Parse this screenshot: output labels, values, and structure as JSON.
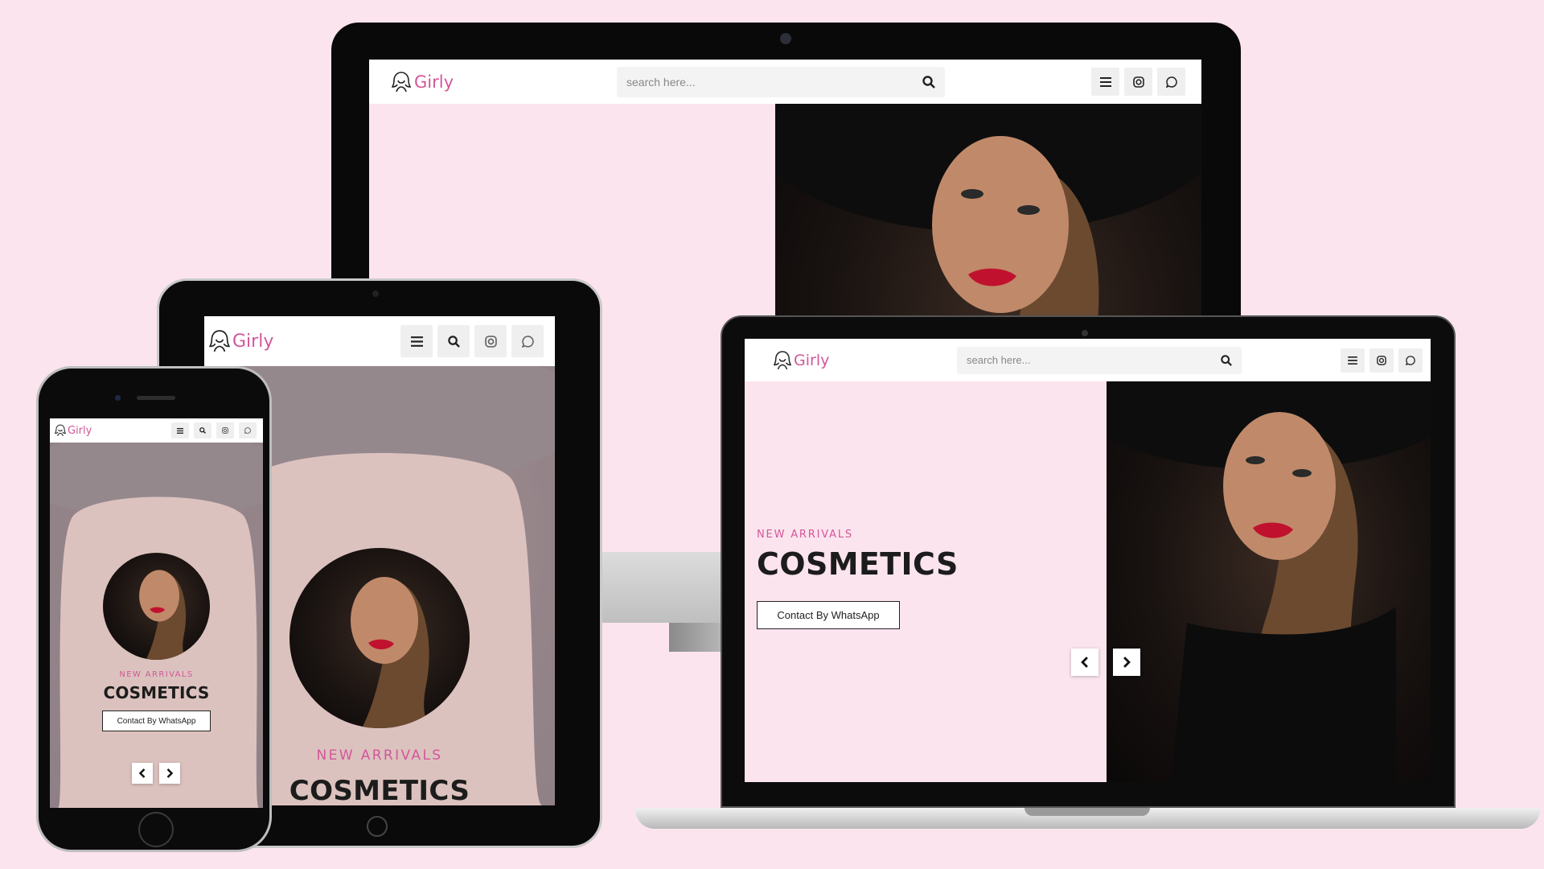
{
  "brand": {
    "name": "Girly",
    "accent": "#d2579a",
    "background": "#fce4ee"
  },
  "search": {
    "placeholder": "search here..."
  },
  "icons": {
    "menu": "menu-icon",
    "search": "search-icon",
    "instagram": "instagram-icon",
    "whatsapp": "whatsapp-icon",
    "prev": "chevron-left-icon",
    "next": "chevron-right-icon"
  },
  "hero": {
    "kicker": "NEW ARRIVALS",
    "title": "COSMETICS",
    "cta": "Contact By WhatsApp"
  }
}
